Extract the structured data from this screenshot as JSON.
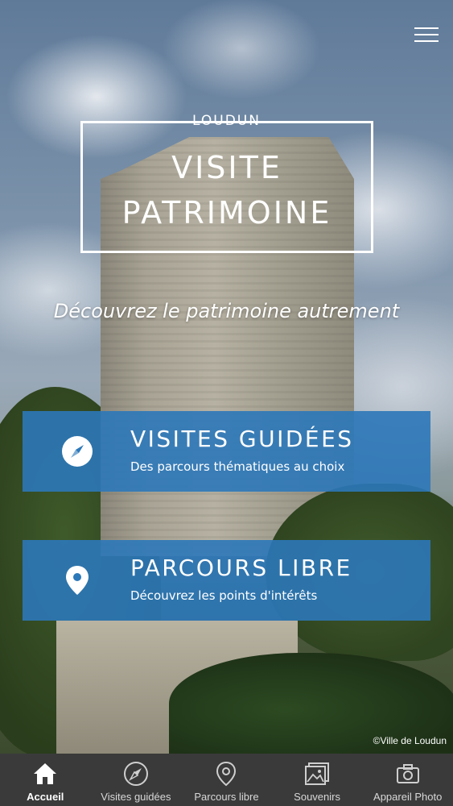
{
  "header": {
    "city": "LOUDUN",
    "title_line1": "VISITE",
    "title_line2": "PATRIMOINE",
    "tagline": "Découvrez le patrimoine autrement"
  },
  "cards": [
    {
      "title": "VISITES GUIDÉES",
      "subtitle": "Des parcours thématiques au choix",
      "icon": "compass-icon"
    },
    {
      "title": "PARCOURS LIBRE",
      "subtitle": "Découvrez les points d'intérêts",
      "icon": "location-pin-icon"
    }
  ],
  "credit": "©Ville de Loudun",
  "tabs": [
    {
      "label": "Accueil",
      "icon": "home-icon",
      "active": true
    },
    {
      "label": "Visites guidées",
      "icon": "compass-icon",
      "active": false
    },
    {
      "label": "Parcours libre",
      "icon": "location-pin-icon",
      "active": false
    },
    {
      "label": "Souvenirs",
      "icon": "photos-icon",
      "active": false
    },
    {
      "label": "Appareil Photo",
      "icon": "camera-icon",
      "active": false
    }
  ],
  "colors": {
    "card_bg": "#2c78b9",
    "tabbar_bg": "#3a3a3a"
  }
}
